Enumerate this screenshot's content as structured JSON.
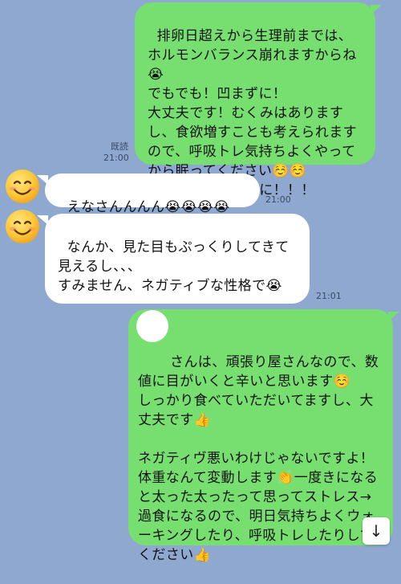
{
  "messages": [
    {
      "direction": "outgoing",
      "text": "排卵日超えから生理前までは、ホルモンバランス崩れますからね😭\nでもでも！凹まずに！\n大丈夫です！むくみはありますし、食欲増すことも考えられますので、呼吸トレ気持ちよくやってから眠ってください☺️☺️\n体重に意識向けずに！！！",
      "read_label": "既読",
      "time": "21:00"
    },
    {
      "direction": "incoming",
      "sender_icon": "smiling-face-icon",
      "text": "えなさんんんん😭😭😭😭",
      "time": "21:00"
    },
    {
      "direction": "incoming",
      "sender_icon": "smiling-face-icon",
      "text": "なんか、見た目もぷっくりしてきて見えるし、、、\nすみません、ネガティブな性格で😭",
      "time": "21:01"
    },
    {
      "direction": "outgoing",
      "text": "さんは、頑張り屋さんなので、数値に目がいくと辛いと思います☺️\nしっかり食べていただいてますし、大丈夫です👍\n\nネガティヴ悪いわけじゃないですよ！\n体重なんて変動します👏一度きになると太った太ったって思ってストレス→過食になるので、明日気持ちよくウォーキングしたり、呼吸トレしたりしてください👍"
    }
  ],
  "scroll_button": {
    "icon": "arrow-down-icon",
    "glyph": "↓"
  },
  "colors": {
    "background": "#8FA8CF",
    "outgoing_bubble": "#77DF6F",
    "incoming_bubble": "#FFFFFF"
  }
}
